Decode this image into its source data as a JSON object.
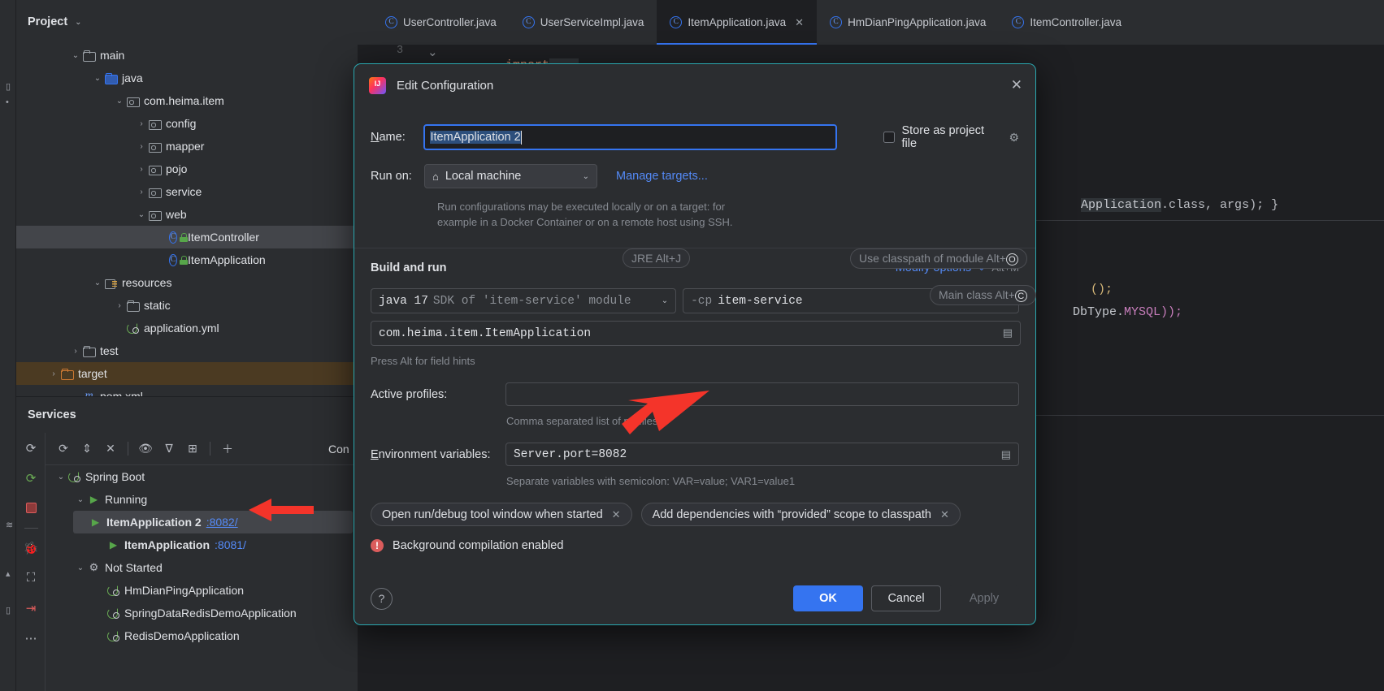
{
  "window": {
    "project_panel_title": "Project",
    "services_panel_title": "Services",
    "console_label": "Con"
  },
  "project_tree": [
    {
      "label": "main",
      "icon": "folder",
      "arrow": "down",
      "indent": 0
    },
    {
      "label": "java",
      "icon": "folder-blue",
      "arrow": "down",
      "indent": 1
    },
    {
      "label": "com.heima.item",
      "icon": "package",
      "arrow": "down",
      "indent": 2
    },
    {
      "label": "config",
      "icon": "package",
      "arrow": "right",
      "indent": 3
    },
    {
      "label": "mapper",
      "icon": "package",
      "arrow": "right",
      "indent": 3
    },
    {
      "label": "pojo",
      "icon": "package",
      "arrow": "right",
      "indent": 3
    },
    {
      "label": "service",
      "icon": "package",
      "arrow": "right",
      "indent": 3
    },
    {
      "label": "web",
      "icon": "package",
      "arrow": "down",
      "indent": 3
    },
    {
      "label": "ItemController",
      "icon": "class-lock",
      "arrow": "none",
      "indent": 4,
      "selected": true
    },
    {
      "label": "ItemApplication",
      "icon": "class-run-lock",
      "arrow": "none",
      "indent": 4
    },
    {
      "label": "resources",
      "icon": "resources",
      "arrow": "down",
      "indent": 1
    },
    {
      "label": "static",
      "icon": "folder",
      "arrow": "right",
      "indent": 2
    },
    {
      "label": "application.yml",
      "icon": "spring-leaf",
      "arrow": "none",
      "indent": 2
    },
    {
      "label": "test",
      "icon": "folder",
      "arrow": "right",
      "indent": 0
    },
    {
      "label": "target",
      "icon": "folder-orange",
      "arrow": "right",
      "indent": -1,
      "highlight": true
    },
    {
      "label": "pom.xml",
      "icon": "maven",
      "arrow": "none",
      "indent": 0
    }
  ],
  "services_tree": [
    {
      "label": "Spring Boot",
      "icon": "spring-leaf",
      "arrow": "down",
      "indent": 0
    },
    {
      "label": "Running",
      "icon": "play",
      "arrow": "down",
      "indent": 1
    },
    {
      "label": "ItemApplication 2",
      "port": ":8082/",
      "icon": "play",
      "arrow": "none",
      "indent": 2,
      "selected": true,
      "bold": true
    },
    {
      "label": "ItemApplication",
      "port": ":8081/",
      "icon": "play",
      "arrow": "none",
      "indent": 2,
      "bold": true
    },
    {
      "label": "Not Started",
      "icon": "gear",
      "arrow": "down",
      "indent": 1
    },
    {
      "label": "HmDianPingApplication",
      "icon": "spring-leaf",
      "arrow": "none",
      "indent": 2
    },
    {
      "label": "SpringDataRedisDemoApplication",
      "icon": "spring-leaf",
      "arrow": "none",
      "indent": 2
    },
    {
      "label": "RedisDemoApplication",
      "icon": "spring-leaf",
      "arrow": "none",
      "indent": 2
    }
  ],
  "editor_tabs": [
    {
      "label": "UserController.java",
      "active": false,
      "closable": false
    },
    {
      "label": "UserServiceImpl.java",
      "active": false,
      "closable": false
    },
    {
      "label": "ItemApplication.java",
      "active": true,
      "closable": true
    },
    {
      "label": "HmDianPingApplication.java",
      "active": false,
      "closable": false
    },
    {
      "label": "ItemController.java",
      "active": false,
      "closable": false
    }
  ],
  "editor_code": {
    "line_number": "3",
    "import_keyword": "import",
    "import_ellipsis": "...",
    "fragment_1": "Application",
    "fragment_1b": ".class, args); }",
    "fragment_2": "();",
    "fragment_3": "DbType.",
    "fragment_3b": "MYSQL));"
  },
  "dialog": {
    "title": "Edit Configuration",
    "close_icon": "close-icon",
    "name_label": "Name:",
    "name_value": "ItemApplication 2",
    "store_as_project_file": "Store as project file",
    "run_on_label": "Run on:",
    "run_on_value": "Local machine",
    "manage_targets_link": "Manage targets...",
    "run_hint_line1": "Run configurations may be executed locally or on a target: for",
    "run_hint_line2": "example in a Docker Container or on a remote host using SSH.",
    "build_and_run_title": "Build and run",
    "modify_options_link": "Modify options",
    "modify_options_shortcut": "Alt+M",
    "tooltip_jre": "JRE Alt+J",
    "tooltip_classpath": "Use classpath of module Alt+O",
    "tooltip_mainclass": "Main class Alt+C",
    "jre_value": "java 17",
    "jre_hint": "SDK of 'item-service' module",
    "cp_flag": "-cp",
    "cp_module": "item-service",
    "main_class_value": "com.heima.item.ItemApplication",
    "press_alt_hint": "Press Alt for field hints",
    "active_profiles_label": "Active profiles:",
    "active_profiles_value": "",
    "active_profiles_hint": "Comma separated list of profiles",
    "env_vars_label": "Environment variables:",
    "env_vars_value": "Server.port=8082",
    "env_vars_hint": "Separate variables with semicolon: VAR=value; VAR1=value1",
    "chip_1": "Open run/debug tool window when started",
    "chip_2": "Add dependencies with “provided” scope to classpath",
    "background_compilation": "Background compilation enabled",
    "help_icon": "?",
    "ok_button": "OK",
    "cancel_button": "Cancel",
    "apply_button": "Apply"
  },
  "colors": {
    "accent_blue": "#3574f0",
    "link_blue": "#548af7",
    "dialog_border": "#2aa8b0",
    "panel_bg": "#2b2d30",
    "editor_bg": "#1e1f22",
    "arrow_red": "#f4342a",
    "selection_bg": "#2d4f7c",
    "error_red": "#db5c5c",
    "green": "#57a64a",
    "target_highlight": "#4b3a22"
  }
}
